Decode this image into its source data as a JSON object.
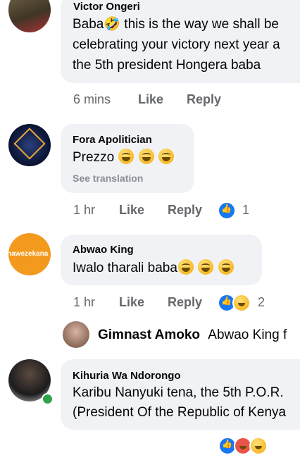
{
  "comments": [
    {
      "author": "Victor Ongeri",
      "lines": [
        "Baba🤣 this is the way we shall be",
        "celebrating your victory next year a",
        "the 5th president Hongera baba"
      ],
      "time": "6 mins",
      "like": "Like",
      "reply": "Reply"
    },
    {
      "author": "Fora Apolitician",
      "text": "Prezzo",
      "see_translation": "See translation",
      "time": "1 hr",
      "like": "Like",
      "reply": "Reply",
      "reaction_count": "1"
    },
    {
      "author": "Abwao King",
      "avatar_text": "nawezekana",
      "text": "Iwalo tharali baba",
      "time": "1 hr",
      "like": "Like",
      "reply": "Reply",
      "reaction_count": "2"
    },
    {
      "author": "Gimnast Amoko",
      "text": "Abwao King f"
    },
    {
      "author": "Kihuria Wa Ndorongo",
      "lines": [
        "Karibu Nanyuki tena, the 5th P.O.R.",
        "(President Of the Republic of Kenya"
      ]
    }
  ],
  "colors": {
    "bubble": "#f0f2f5",
    "like_blue": "#1877f2",
    "online_green": "#31a24c",
    "meta_grey": "#65676b"
  },
  "icons": [
    "like-reaction-icon",
    "haha-reaction-icon",
    "grinning-sweat-emoji"
  ]
}
